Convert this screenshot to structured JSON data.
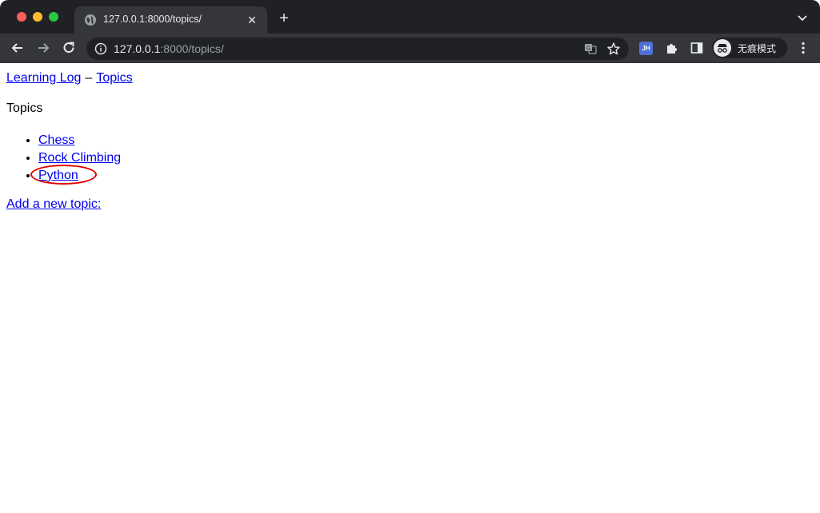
{
  "browser": {
    "tab": {
      "title": "127.0.0.1:8000/topics/"
    },
    "address": {
      "host": "127.0.0.1",
      "rest": ":8000/topics/"
    },
    "extension_jh": "JH",
    "incognito_label": "无痕模式"
  },
  "page": {
    "header": {
      "home_link": "Learning Log",
      "separator": "–",
      "topics_link": "Topics"
    },
    "heading": "Topics",
    "topics": [
      "Chess",
      "Rock Climbing",
      "Python"
    ],
    "add_link": "Add a new topic:"
  },
  "icons": {
    "tab_favicon": "globe-icon",
    "tab_close": "close-icon",
    "new_tab": "plus-icon",
    "tab_search": "chevron-down-icon",
    "back": "back-arrow-icon",
    "forward": "forward-arrow-icon",
    "reload": "reload-icon",
    "site_info": "info-icon",
    "translate": "translate-icon",
    "bookmark": "star-icon",
    "extensions": "puzzle-icon",
    "side_panel": "side-panel-icon",
    "incognito": "incognito-icon",
    "menu": "kebab-menu-icon"
  },
  "colors": {
    "link": "#0000ee",
    "highlight": "#e00000",
    "chrome_dark": "#202124",
    "chrome_toolbar": "#35363a"
  }
}
